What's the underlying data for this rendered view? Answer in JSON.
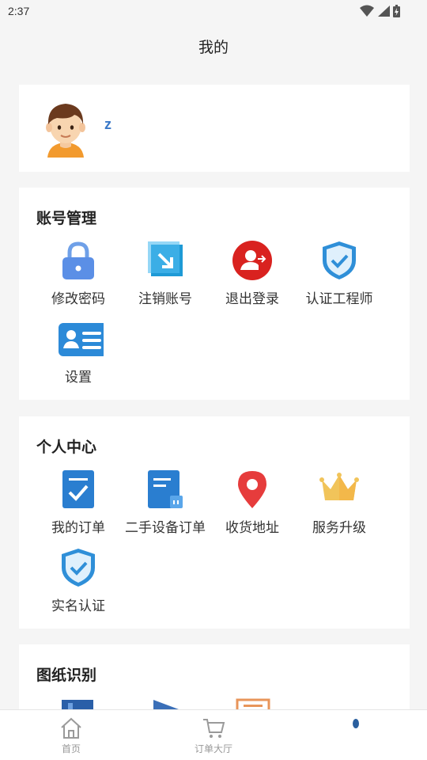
{
  "status_bar": {
    "time": "2:37"
  },
  "header": {
    "title": "我的"
  },
  "profile": {
    "username": "z"
  },
  "account_section": {
    "title": "账号管理",
    "items": [
      {
        "label": "修改密码",
        "icon": "lock-icon"
      },
      {
        "label": "注销账号",
        "icon": "cancel-account-icon"
      },
      {
        "label": "退出登录",
        "icon": "logout-icon"
      },
      {
        "label": "认证工程师",
        "icon": "shield-check-icon"
      },
      {
        "label": "设置",
        "icon": "id-card-icon"
      }
    ]
  },
  "personal_section": {
    "title": "个人中心",
    "items": [
      {
        "label": "我的订单",
        "icon": "order-check-icon"
      },
      {
        "label": "二手设备订单",
        "icon": "device-order-icon"
      },
      {
        "label": "收货地址",
        "icon": "location-pin-icon"
      },
      {
        "label": "服务升级",
        "icon": "crown-icon"
      },
      {
        "label": "实名认证",
        "icon": "shield-check-icon"
      }
    ]
  },
  "drawing_section": {
    "title": "图纸识别"
  },
  "tab_bar": {
    "tabs": [
      {
        "label": "首页",
        "icon": "home-icon"
      },
      {
        "label": "订单大厅",
        "icon": "cart-icon"
      },
      {
        "label": "",
        "icon": "profile-icon"
      }
    ]
  },
  "colors": {
    "accent_blue": "#3a78c8",
    "logout_red": "#d9221f",
    "crown_gold": "#f1c45a"
  }
}
